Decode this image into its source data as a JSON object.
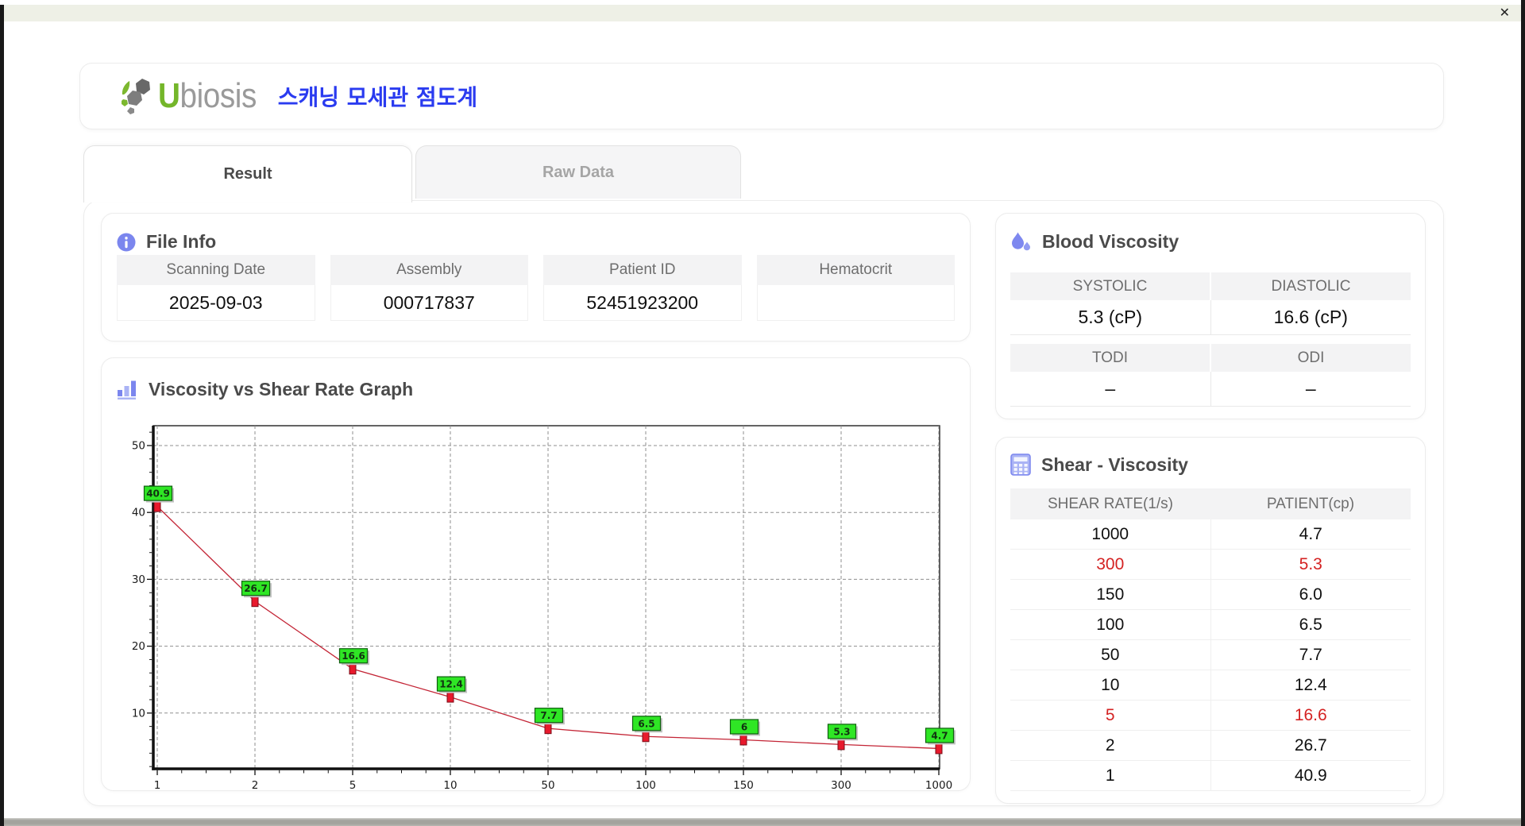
{
  "window": {
    "close_label": "✕"
  },
  "header": {
    "logo_u": "U",
    "logo_rest": "biosis",
    "app_title": "스캐닝 모세관 점도계"
  },
  "tabs": {
    "result": "Result",
    "raw": "Raw Data"
  },
  "file_info": {
    "title": "File Info",
    "fields": [
      {
        "label": "Scanning Date",
        "value": "2025-09-03"
      },
      {
        "label": "Assembly",
        "value": "000717837"
      },
      {
        "label": "Patient ID",
        "value": "52451923200"
      },
      {
        "label": "Hematocrit",
        "value": ""
      }
    ]
  },
  "blood_viscosity": {
    "title": "Blood Viscosity",
    "groups": [
      {
        "headers": [
          "SYSTOLIC",
          "DIASTOLIC"
        ],
        "values": [
          "5.3 (cP)",
          "16.6 (cP)"
        ]
      },
      {
        "headers": [
          "TODI",
          "ODI"
        ],
        "values": [
          "–",
          "–"
        ]
      }
    ]
  },
  "shear_viscosity": {
    "title": "Shear - Viscosity",
    "columns": [
      "SHEAR RATE(1/s)",
      "PATIENT(cp)"
    ],
    "rows": [
      {
        "shear_rate": "1000",
        "patient": "4.7",
        "highlight": false
      },
      {
        "shear_rate": "300",
        "patient": "5.3",
        "highlight": true
      },
      {
        "shear_rate": "150",
        "patient": "6.0",
        "highlight": false
      },
      {
        "shear_rate": "100",
        "patient": "6.5",
        "highlight": false
      },
      {
        "shear_rate": "50",
        "patient": "7.7",
        "highlight": false
      },
      {
        "shear_rate": "10",
        "patient": "12.4",
        "highlight": false
      },
      {
        "shear_rate": "5",
        "patient": "16.6",
        "highlight": true
      },
      {
        "shear_rate": "2",
        "patient": "26.7",
        "highlight": false
      },
      {
        "shear_rate": "1",
        "patient": "40.9",
        "highlight": false
      }
    ]
  },
  "graph": {
    "title": "Viscosity vs Shear Rate Graph"
  },
  "chart_data": {
    "type": "line",
    "x": [
      1,
      2,
      5,
      10,
      50,
      100,
      150,
      300,
      1000
    ],
    "x_scale": "categorical-evenly-spaced",
    "series": [
      {
        "name": "patient-viscosity",
        "values": [
          40.9,
          26.7,
          16.6,
          12.4,
          7.7,
          6.5,
          6,
          5.3,
          4.7
        ]
      }
    ],
    "point_labels": [
      "40.9",
      "26.7",
      "16.6",
      "12.4",
      "7.7",
      "6.5",
      "6",
      "5.3",
      "4.7"
    ],
    "y_ticks": [
      10,
      20,
      30,
      40,
      50
    ],
    "ylim": [
      1.6,
      53.1
    ],
    "grid": true,
    "title": "",
    "xlabel": "",
    "ylabel": "",
    "line_color": "#c32435",
    "marker_color": "#e8192c",
    "marker_border": "#7a0d18",
    "label_bg": "#2fe625",
    "label_border": "#0f5f0f",
    "label_text": "#113311"
  }
}
